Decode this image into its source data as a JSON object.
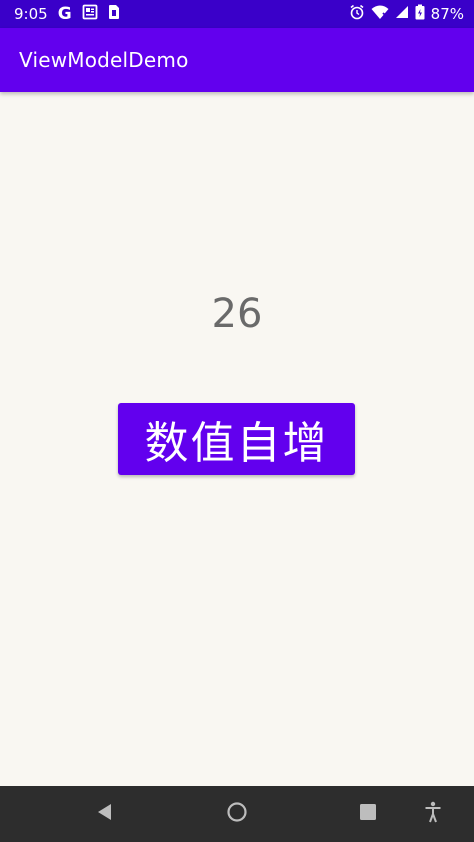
{
  "status_bar": {
    "time": "9:05",
    "battery": "87%",
    "icons": [
      "google-g-icon",
      "news-icon",
      "sim-icon",
      "alarm-icon",
      "wifi-icon",
      "signal-icon",
      "battery-icon"
    ]
  },
  "app_bar": {
    "title": "ViewModelDemo",
    "color": "#6200ee"
  },
  "main": {
    "counter_value": "26",
    "button_label": "数值自增"
  },
  "nav_bar": {
    "icons": [
      "back-icon",
      "home-icon",
      "recents-icon",
      "accessibility-icon"
    ]
  },
  "colors": {
    "status_bar": "#3a00c9",
    "primary": "#6200ee",
    "background": "#f9f7f2",
    "nav_bar": "#2d2d2d"
  }
}
